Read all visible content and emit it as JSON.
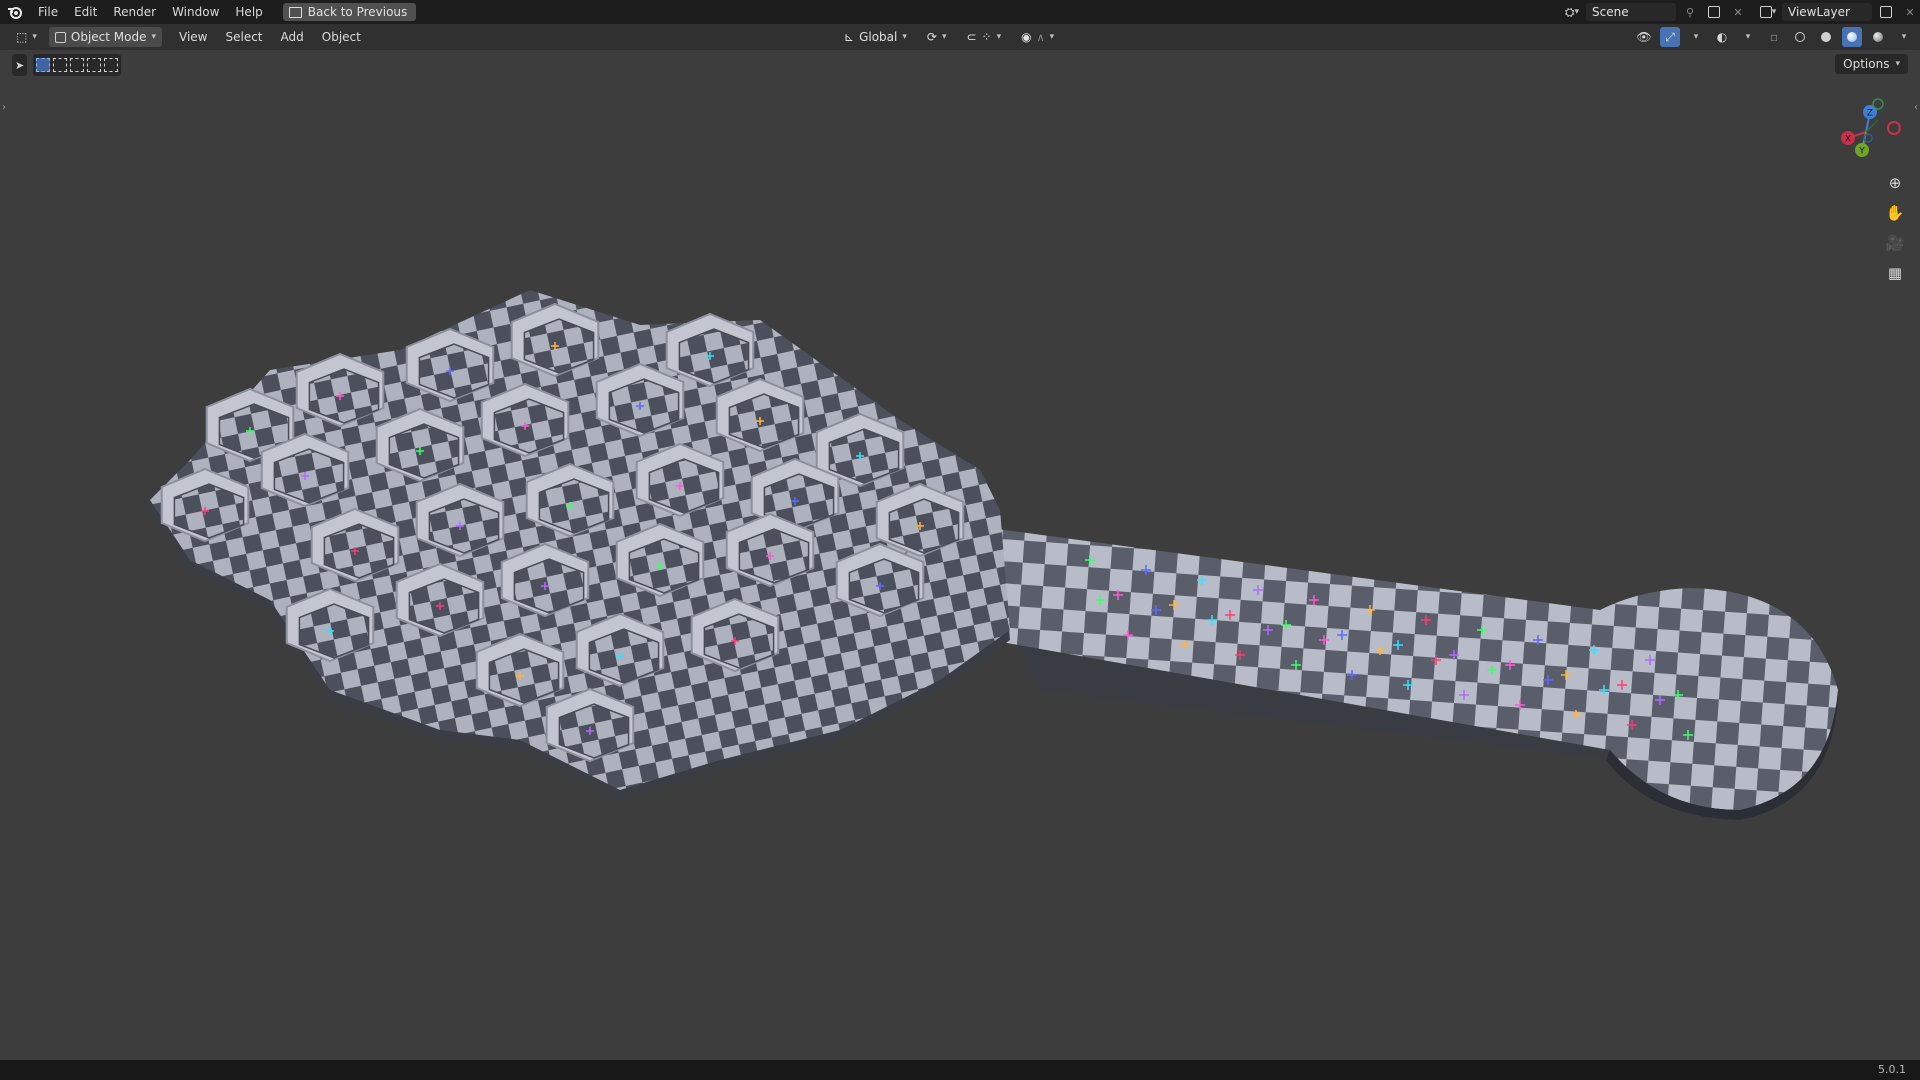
{
  "topbar": {
    "menus": [
      "File",
      "Edit",
      "Render",
      "Window",
      "Help"
    ],
    "back_button": "Back to Previous",
    "scene": "Scene",
    "view_layer": "ViewLayer"
  },
  "header": {
    "mode": "Object Mode",
    "menus": [
      "View",
      "Select",
      "Add",
      "Object"
    ],
    "transform_orientation": "Global"
  },
  "toolbar": {
    "options_label": "Options"
  },
  "gizmo": {
    "x_label": "X",
    "y_label": "Y",
    "z_label": "Z"
  },
  "status": {
    "version": "5.0.1"
  },
  "colors": {
    "accent": "#4772b3",
    "axis_x": "#c9304a",
    "axis_y": "#6fa52a",
    "axis_z": "#3d7fd6",
    "checker_light": "#b8bcc8",
    "checker_dark": "#5a5e6a"
  },
  "icons": [
    "blender-logo",
    "back-icon",
    "scene-icon",
    "pin-icon",
    "copy-icon",
    "viewlayer-icon",
    "editor-type-icon",
    "object-mode-icon",
    "global-orientation-icon",
    "pivot-icon",
    "snap-icon",
    "proportional-edit-icon",
    "visibility-icon",
    "gizmo-icon",
    "overlay-icon",
    "xray-icon",
    "wireframe-shading-icon",
    "solid-shading-icon",
    "material-shading-icon",
    "rendered-shading-icon",
    "select-tool-icon",
    "zoom-icon",
    "pan-hand-icon",
    "camera-icon",
    "grid-icon"
  ]
}
